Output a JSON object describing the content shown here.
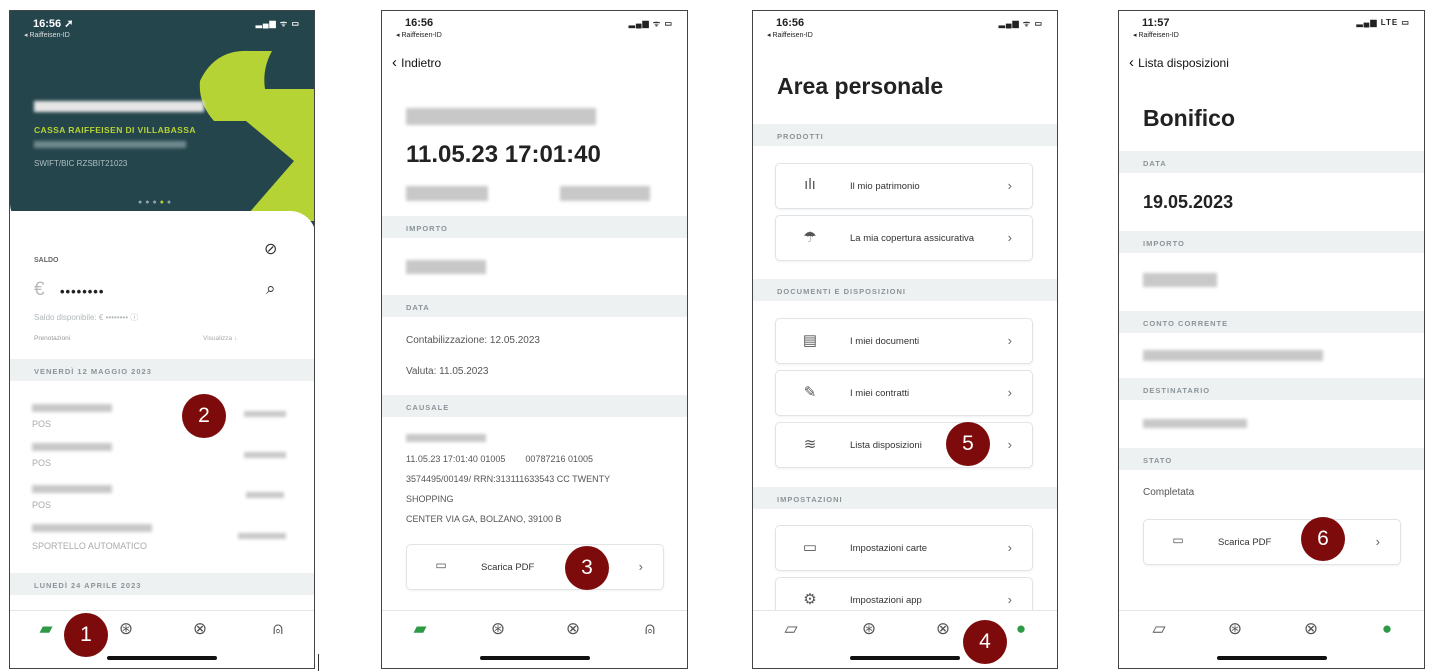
{
  "status": {
    "t1": "16:56 ➚",
    "t2": "16:56",
    "t3": "16:56",
    "t4": "11:57",
    "carrier": "◂ Raiffeisen-ID",
    "sig": "▂▄▆ ᯤ ▭",
    "sig4": "▂▄▆ LTE ▭"
  },
  "s1": {
    "bank": "CASSA RAIFFEISEN DI VILLABASSA",
    "bic": "SWIFT/BIC RZSBIT21023",
    "saldo_label": "SALDO",
    "saldo_mask": "••••••••",
    "disp": "Saldo disponibile: € •••••••• ⓘ",
    "prenot": "Prenotazioni",
    "visual": "Visualizza ↓",
    "date1": "VENERDÌ 12 MAGGIO 2023",
    "pos1": "POS",
    "pos2": "POS",
    "pos3": "POS",
    "sportello": "SPORTELLO AUTOMATICO",
    "date2": "LUNEDÌ 24 APRILE 2023",
    "badge1": "1",
    "badge2": "2"
  },
  "s2": {
    "back": "Indietro",
    "datetime": "11.05.23 17:01:40",
    "importo": "IMPORTO",
    "data": "DATA",
    "contab": "Contabilizzazione: 12.05.2023",
    "valuta": "Valuta: 11.05.2023",
    "causale": "CAUSALE",
    "c1": "11.05.23 17:01:40 01005        00787216 01005",
    "c2": "3574495/00149/ RRN:313111633543 CC TWENTY",
    "c3": "SHOPPING",
    "c4": "CENTER VIA GA, BOLZANO, 39100 B",
    "pdf": "Scarica PDF",
    "badge3": "3"
  },
  "s3": {
    "title": "Area personale",
    "prodotti": "PRODOTTI",
    "patrimonio": "Il mio patrimonio",
    "copertura": "La mia copertura assicurativa",
    "docdisp": "DOCUMENTI E DISPOSIZIONI",
    "documenti": "I miei documenti",
    "contratti": "I miei contratti",
    "lista": "Lista disposizioni",
    "impostazioni": "IMPOSTAZIONI",
    "carte": "Impostazioni carte",
    "app": "Impostazioni app",
    "badge4": "4",
    "badge5": "5"
  },
  "s4": {
    "back": "Lista disposizioni",
    "title": "Bonifico",
    "data": "DATA",
    "date": "19.05.2023",
    "importo": "IMPORTO",
    "conto": "CONTO CORRENTE",
    "dest": "DESTINATARIO",
    "stato": "STATO",
    "completata": "Completata",
    "pdf": "Scarica PDF",
    "badge6": "6"
  },
  "colors": {
    "green": "#2e9a45",
    "lime": "#b5d334",
    "dark": "#25454c",
    "badge": "#7d0b0b"
  }
}
